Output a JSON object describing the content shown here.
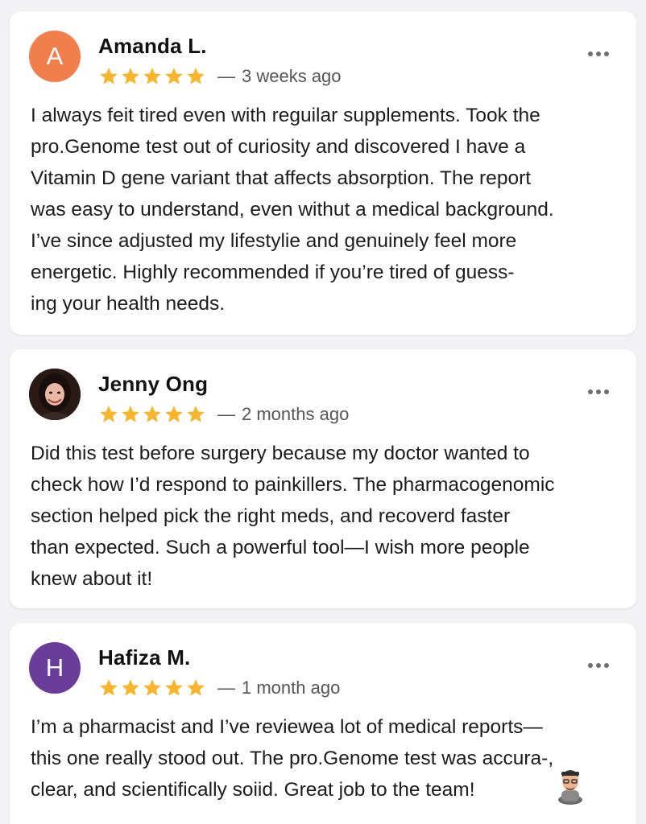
{
  "colors": {
    "star": "#f7b52c",
    "avatar_amanda": "#f07f4c",
    "avatar_hafiza": "#6a3d9a"
  },
  "reviews": [
    {
      "avatar_letter": "A",
      "name": "Amanda L.",
      "rating": 5,
      "dash": "—",
      "time": "3 weeks ago",
      "lines": [
        "I always feit tired even with reguilar supplements. Took the",
        "pro.Genome test out of curiosity and discovered I have a",
        "Vitamin D gene variant that affects absorption. The report",
        "was easy to understand, even withut a medical background.",
        "I’ve since adjusted my lifestylie and genuinely feel more",
        "energetic. Highly recommended if you’re tired of guess-",
        "ing your health needs."
      ]
    },
    {
      "avatar_letter": "",
      "avatar_icon": "profile-photo",
      "name": "Jenny Ong",
      "rating": 5,
      "dash": "—",
      "time": "2 months ago",
      "lines": [
        "Did this test before surgery because my doctor wanted to",
        "check how I’d respond to painkillers. The pharmacogenomic",
        "section helped pick the right meds, and recoverd faster",
        "than expected. Such a powerful tool—I wish more people",
        "knew about it!"
      ]
    },
    {
      "avatar_letter": "H",
      "name": "Hafiza M.",
      "rating": 5,
      "dash": "—",
      "time": "1 month ago",
      "lines": [
        "I’m a pharmacist and I’ve reviewea lot of medical reports—",
        "this one really stood out. The pro.Genome test was accura-,",
        "clear, and scientifically soiid. Great job to the team!"
      ],
      "sticker_icon": "person-sticker-icon"
    }
  ]
}
